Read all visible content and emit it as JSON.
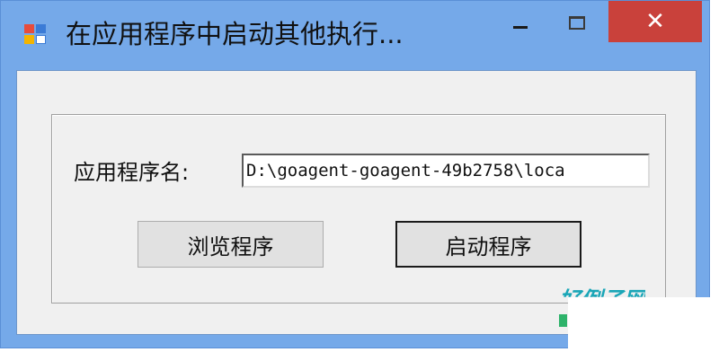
{
  "window": {
    "title": "在应用程序中启动其他执行...",
    "controls": {
      "minimize_icon": "minimize-icon",
      "maximize_icon": "maximize-icon",
      "close_symbol": "✕"
    },
    "colors": {
      "titlebar": "#75a9e9",
      "close": "#c9413b",
      "client": "#f0f0f0"
    }
  },
  "form": {
    "app_name_label": "应用程序名:",
    "app_path_value": "D:\\goagent-goagent-49b2758\\loca",
    "browse_button": "浏览程序",
    "start_button": "启动程序"
  },
  "watermark": {
    "text": "好例子网"
  }
}
